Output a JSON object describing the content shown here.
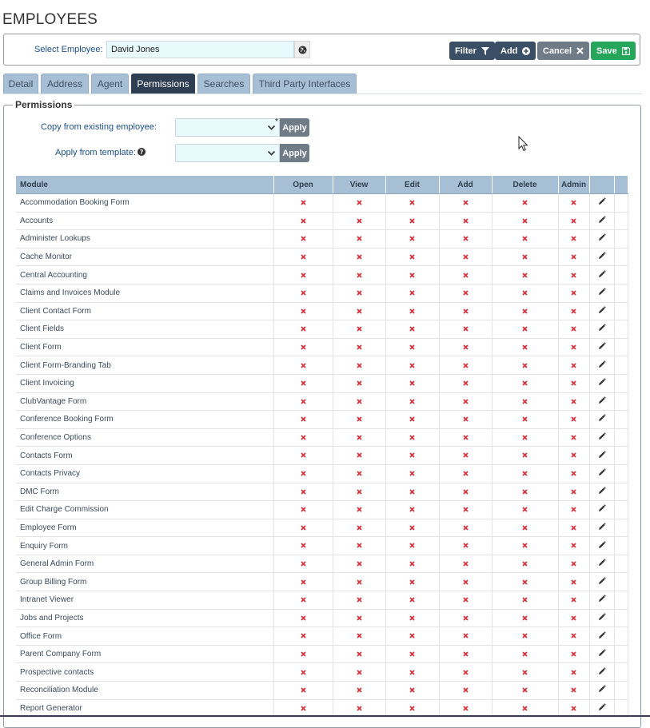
{
  "page": {
    "title": "EMPLOYEES"
  },
  "selector": {
    "label": "Select Employee:",
    "value": "David Jones",
    "globe_icon": "globe-icon"
  },
  "toolbar": {
    "filter_label": "Filter",
    "add_label": "Add",
    "cancel_label": "Cancel",
    "save_label": "Save"
  },
  "tabs": [
    {
      "label": "Detail",
      "active": false
    },
    {
      "label": "Address",
      "active": false
    },
    {
      "label": "Agent",
      "active": false
    },
    {
      "label": "Permissions",
      "active": true
    },
    {
      "label": "Searches",
      "active": false
    },
    {
      "label": "Third Party Interfaces",
      "active": false
    }
  ],
  "permissions": {
    "legend": "Permissions",
    "copy_label": "Copy from existing employee:",
    "template_label": "Apply from template:",
    "required_mark": "*",
    "apply_label": "Apply",
    "columns": [
      "Module",
      "Open",
      "View",
      "Edit",
      "Add",
      "Delete",
      "Admin"
    ],
    "rows": [
      "Accommodation Booking Form",
      "Accounts",
      "Administer Lookups",
      "Cache Monitor",
      "Central Accounting",
      "Claims and Invoices Module",
      "Client Contact Form",
      "Client Fields",
      "Client Form",
      "Client Form-Branding Tab",
      "Client Invoicing",
      "ClubVantage Form",
      "Conference Booking Form",
      "Conference Options",
      "Contacts Form",
      "Contacts Privacy",
      "DMC Form",
      "Edit Charge Commission",
      "Employee Form",
      "Enquiry Form",
      "General Admin Form",
      "Group Billing Form",
      "Intranet Viewer",
      "Jobs and Projects",
      "Office Form",
      "Parent Company Form",
      "Prospective contacts",
      "Reconciliation Module",
      "Report Generator"
    ]
  },
  "colors": {
    "header_bg": "#a7bfd4",
    "active_tab": "#2e3f53",
    "deny_icon": "#d9303a",
    "save_green": "#25a65a"
  }
}
